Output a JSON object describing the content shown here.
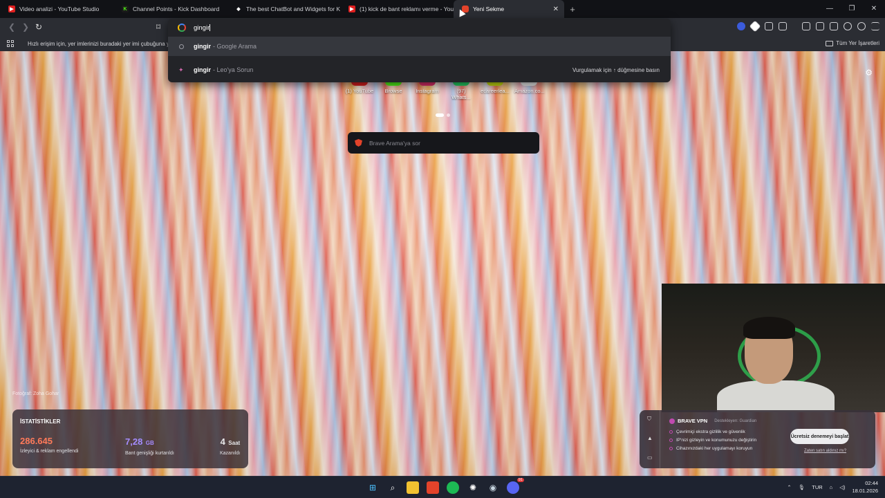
{
  "tabs": [
    {
      "title": "Video analizi - YouTube Studio",
      "favicon": "youtube-icon",
      "color": "#e02020"
    },
    {
      "title": "Channel Points - Kick Dashboard",
      "favicon": "kick-icon",
      "color": "#53fc18"
    },
    {
      "title": "The best ChatBot and Widgets for Ki",
      "favicon": "botrix-icon",
      "color": "#ffffff"
    },
    {
      "title": "(1) kick de bant reklamı verme - YouT",
      "favicon": "youtube-icon",
      "color": "#e02020"
    },
    {
      "title": "Yeni Sekme",
      "favicon": "brave-icon",
      "color": "#e3432a",
      "active": true
    }
  ],
  "bookmarks_bar": {
    "hint": "Hızlı erişim için, yer imlerinizi buradaki yer imi çubuğuna y",
    "all_bookmarks": "Tüm Yer İşaretleri"
  },
  "omnibox": {
    "typed": "gingir",
    "suggestions": [
      {
        "bold": "gingir",
        "rest": "- Google Arama",
        "icon": "search-icon"
      },
      {
        "bold": "gingir",
        "rest": "- Leo'ya Sorun",
        "icon": "leo-icon",
        "hint": "Vurgulamak için ↑ düğmesine basın"
      }
    ]
  },
  "top_sites": [
    {
      "label": "(1) YouTube",
      "color": "#e02020"
    },
    {
      "label": "Browse",
      "color": "#53fc18"
    },
    {
      "label": "Instagram",
      "color": "#e1306c"
    },
    {
      "label": "(97) Whats...",
      "color": "#25d366"
    },
    {
      "label": "ecareerlea...",
      "color": "#c8e010"
    },
    {
      "label": "Amazon.co...",
      "color": "#f0f0f0"
    }
  ],
  "brave_search": {
    "placeholder": "Brave Arama'ya sor"
  },
  "photo_credit": "Fotoğraf: Zoha Gohar",
  "stats": {
    "title": "İSTATİSTİKLER",
    "blocked": {
      "value": "286.645",
      "label": "İzleyici & reklam engellendi",
      "color": "#ff7a5a"
    },
    "bandwidth": {
      "value": "7,28",
      "unit": "GB",
      "label": "Bant genişliği kurtarıldı",
      "color": "#a58cff"
    },
    "time": {
      "value": "4",
      "unit": "Saat",
      "label": "Kazanıldı",
      "color": "#ffffff"
    }
  },
  "vpn": {
    "title": "BRAVE VPN",
    "sponsor": "Destekleyen: Guardian",
    "features": [
      "Çevrimiçi ekstra gizlilik ve güvenlik",
      "IP'nizi gizleyin ve konumunuzu değiştirin",
      "Cihazınızdaki her uygulamayı koruyun"
    ],
    "cta": "Ücretsiz denemeyi başlat",
    "link": "Zaten satın aldınız mı?"
  },
  "taskbar": {
    "apps": [
      "windows-start-icon",
      "search-icon",
      "file-explorer-icon",
      "brave-icon",
      "spotify-icon",
      "chatgpt-icon",
      "steam-icon",
      "discord-icon"
    ],
    "discord_badge": "91",
    "language": "TUR",
    "time": "02:44",
    "date": "18.01.2026"
  }
}
